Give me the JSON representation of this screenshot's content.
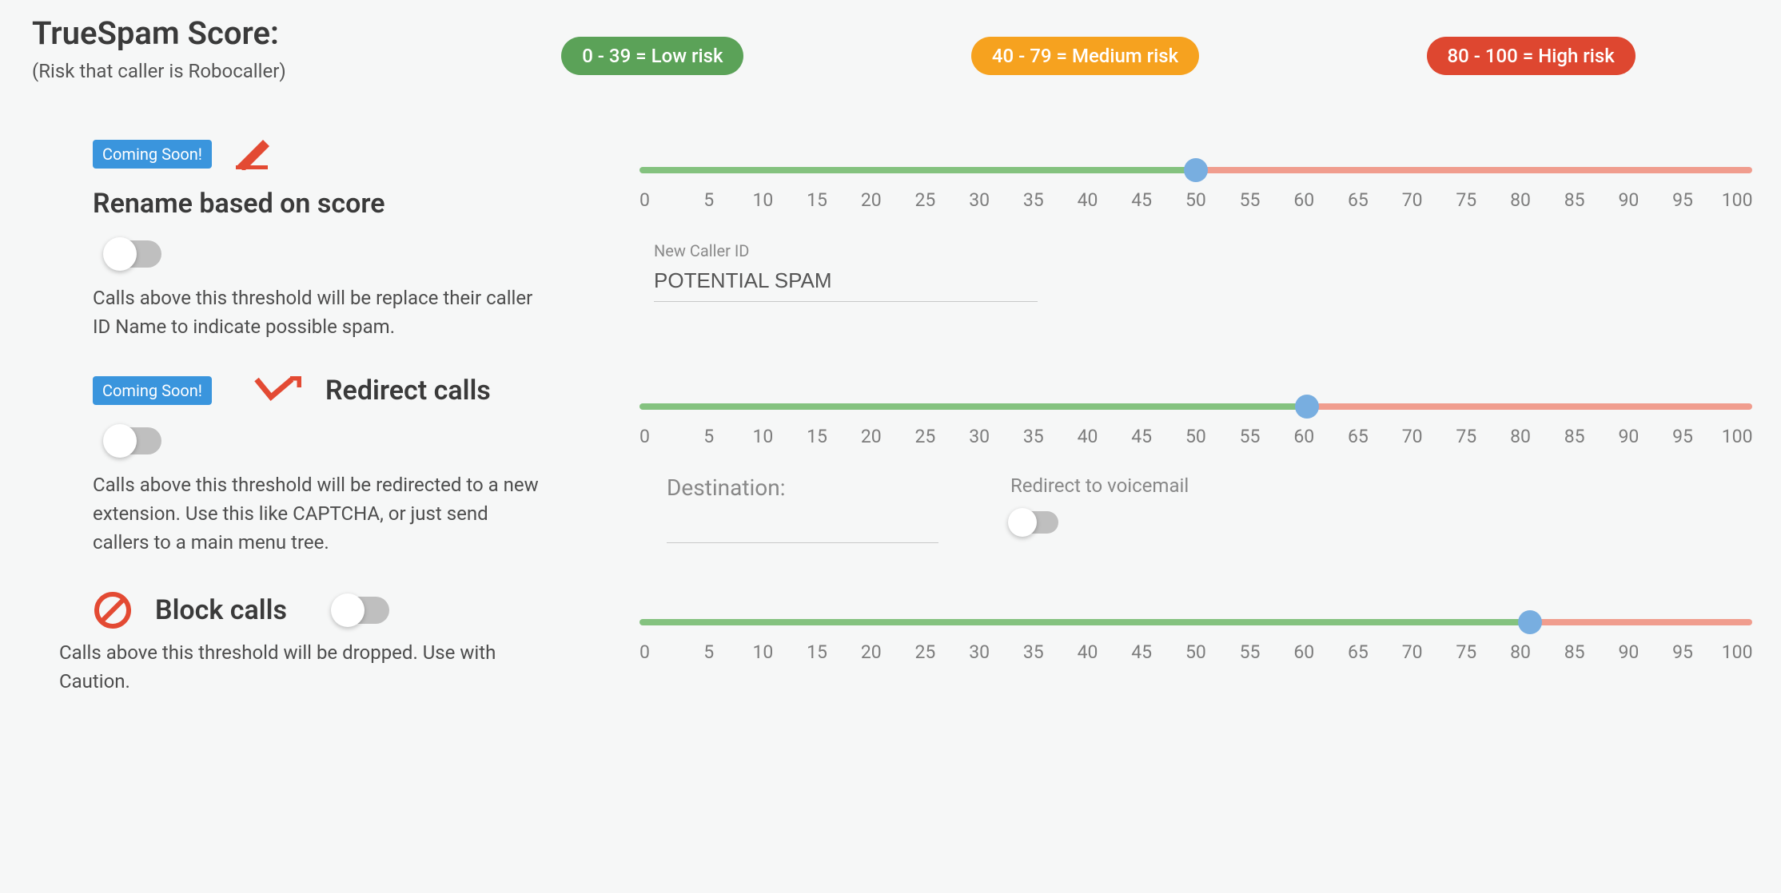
{
  "header": {
    "title": "TrueSpam Score:",
    "subtitle": "(Risk that caller is Robocaller)"
  },
  "risk": {
    "low_label": "0 - 39 = Low risk",
    "medium_label": "40 - 79 = Medium risk",
    "high_label": "80 - 100 = High risk",
    "colors": {
      "low": "#5ba258",
      "medium": "#f6a21f",
      "high": "#de4730"
    }
  },
  "slider_ticks": [
    "0",
    "5",
    "10",
    "15",
    "20",
    "25",
    "30",
    "35",
    "40",
    "45",
    "50",
    "55",
    "60",
    "65",
    "70",
    "75",
    "80",
    "85",
    "90",
    "95",
    "100"
  ],
  "rename": {
    "badge": "Coming Soon!",
    "title": "Rename based on score",
    "desc": "Calls above this threshold will be replace their caller ID Name to indicate possible spam.",
    "threshold": 50,
    "input_label": "New Caller ID",
    "input_value": "POTENTIAL SPAM",
    "enabled": false
  },
  "redirect": {
    "badge": "Coming Soon!",
    "title": "Redirect calls",
    "desc": "Calls above this threshold will be redirected to a new extension. Use this like CAPTCHA, or just send callers to a main menu tree.",
    "threshold": 60,
    "destination_label": "Destination:",
    "destination_value": "",
    "vm_label": "Redirect to voicemail",
    "vm_enabled": false,
    "enabled": false
  },
  "block": {
    "title": "Block calls",
    "desc": "Calls above this threshold will be dropped. Use with Caution.",
    "threshold": 80,
    "enabled": false
  }
}
